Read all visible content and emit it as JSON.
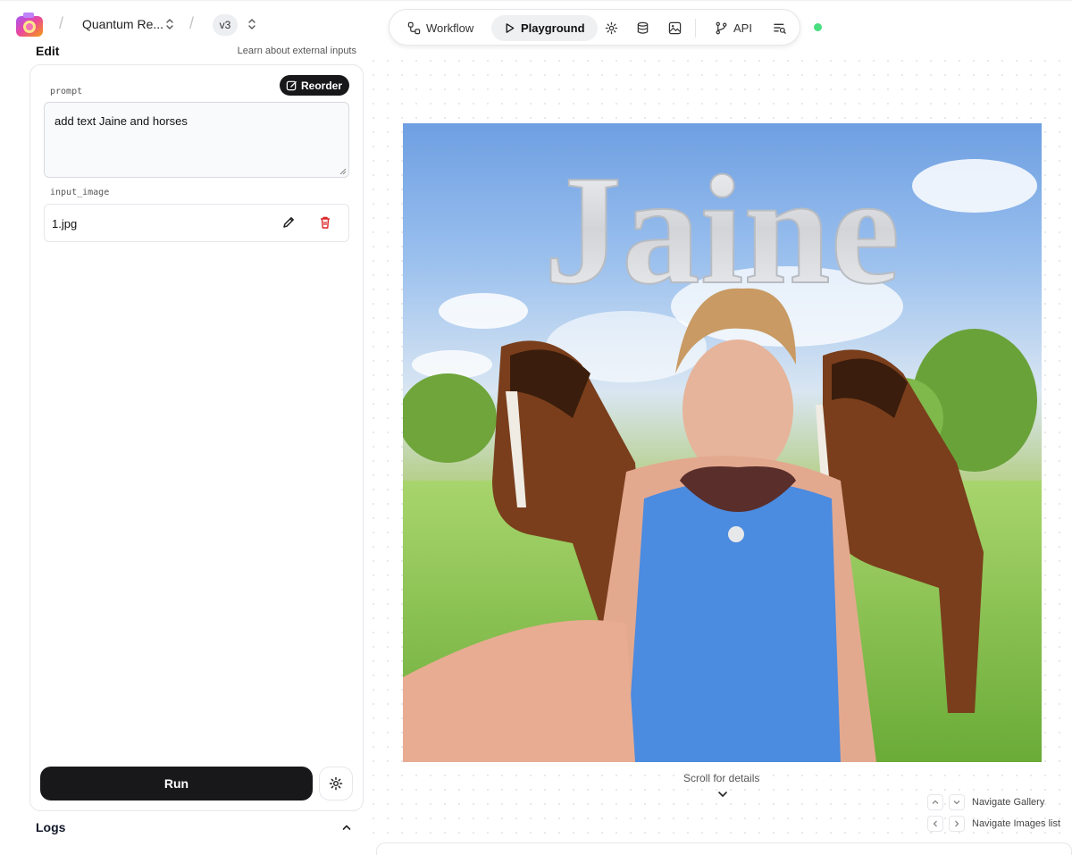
{
  "header": {
    "project_name": "Quantum Re...",
    "version": "v3"
  },
  "edit": {
    "title": "Edit",
    "learn_link": "Learn about external inputs",
    "reorder_label": "Reorder",
    "prompt_label": "prompt",
    "prompt_value": "add text Jaine and horses",
    "input_image_label": "input_image",
    "input_image_file": "1.jpg",
    "run_label": "Run"
  },
  "logs": {
    "title": "Logs"
  },
  "toolbar": {
    "workflow_label": "Workflow",
    "playground_label": "Playground",
    "api_label": "API",
    "active_tab": "Playground"
  },
  "status": {
    "color": "#4ade80"
  },
  "canvas": {
    "image_text": "Jaine",
    "scroll_hint": "Scroll for details",
    "nav_gallery": "Navigate Gallery",
    "nav_images": "Navigate Images list"
  },
  "colors": {
    "primary_button": "#18181b",
    "delete_icon": "#dc2626"
  }
}
